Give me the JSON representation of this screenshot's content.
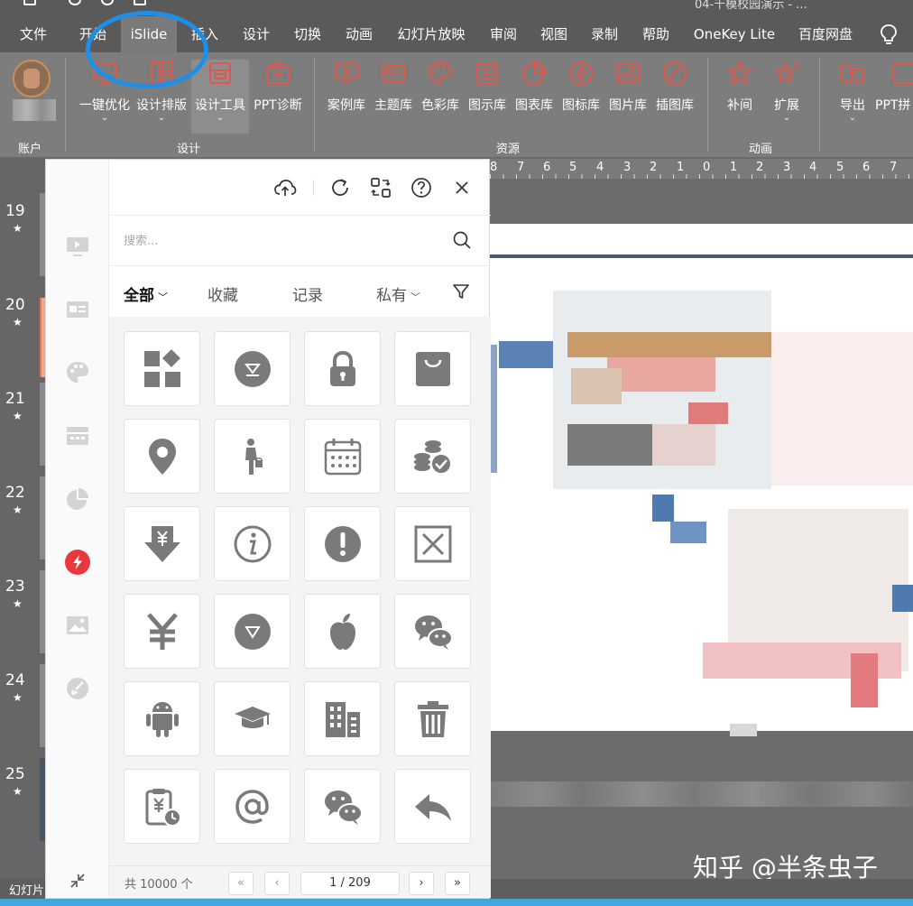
{
  "title_strip": {
    "document_title": "04-千模校园演示 - ..."
  },
  "menu": {
    "tabs": [
      "文件",
      "开始",
      "iSlide",
      "插入",
      "设计",
      "切换",
      "动画",
      "幻灯片放映",
      "审阅",
      "视图",
      "录制",
      "帮助",
      "OneKey Lite",
      "百度网盘"
    ],
    "active": "iSlide"
  },
  "ribbon": {
    "groups": [
      {
        "label": "账户"
      },
      {
        "label": "设计",
        "buttons": [
          "一键优化",
          "设计排版",
          "设计工具",
          "PPT诊断"
        ]
      },
      {
        "label": "资源",
        "buttons": [
          "案例库",
          "主题库",
          "色彩库",
          "图示库",
          "图表库",
          "图标库",
          "图片库",
          "插图库"
        ]
      },
      {
        "label": "动画",
        "buttons": [
          "补间",
          "扩展"
        ]
      },
      {
        "label": "",
        "buttons": [
          "导出",
          "PPT拼"
        ]
      }
    ]
  },
  "slides": {
    "numbers": [
      "19",
      "20",
      "21",
      "22",
      "23",
      "24",
      "25"
    ],
    "star": "★"
  },
  "ruler": {
    "labels": [
      "8",
      "7",
      "6",
      "5",
      "4",
      "3",
      "2",
      "1",
      "0",
      "1",
      "2",
      "3",
      "4",
      "5",
      "6",
      "7"
    ]
  },
  "panel": {
    "search_placeholder": "搜索...",
    "filters": [
      {
        "label": "全部",
        "chevron": "﹀"
      },
      {
        "label": "收藏"
      },
      {
        "label": "记录"
      },
      {
        "label": "私有",
        "chevron": "﹀"
      }
    ],
    "active_filter": "全部",
    "icons": [
      "apps-grid-icon",
      "download-circle-icon",
      "lock-icon",
      "shopping-bag-icon",
      "location-pin-icon",
      "person-shopping-icon",
      "calendar-icon",
      "coins-check-icon",
      "yen-down-arrow-icon",
      "info-circle-icon",
      "exclamation-circle-icon",
      "close-box-icon",
      "yen-icon",
      "triangle-down-circle-icon",
      "apple-icon",
      "wechat-icon",
      "android-icon",
      "graduation-cap-icon",
      "building-icon",
      "trash-icon",
      "clipboard-yen-clock-icon",
      "at-sign-icon",
      "wechat-icon",
      "reply-arrow-icon"
    ],
    "pager": {
      "count": "共 10000 个",
      "first": "«",
      "prev": "‹",
      "page": "1 / 209",
      "next": "›",
      "last": "»"
    }
  },
  "statusbar": {
    "text": "幻灯片"
  },
  "watermark": "知乎 @半条虫子",
  "colors": {
    "accent_red": "#e8383d",
    "highlight_blue": "#1e8fe8",
    "icon_gray": "#7a7a7a",
    "ribbon_red": "#e2574c"
  }
}
